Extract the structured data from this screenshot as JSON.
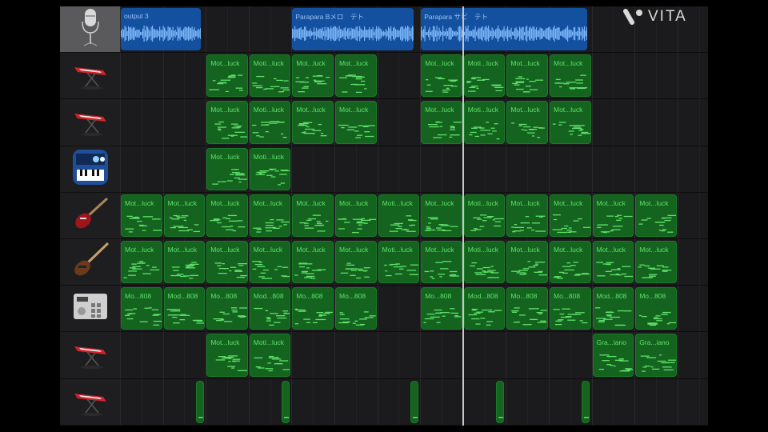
{
  "logo": {
    "text": "VITA"
  },
  "colors": {
    "midi": "#14631f",
    "audio": "#1450a0",
    "midi_text": "#5fe06a",
    "audio_text": "#9cc2f2"
  },
  "tracks": [
    {
      "instrument": "microphone-icon",
      "selected": true,
      "regions": [
        {
          "type": "audio",
          "label": "output 3",
          "start": 0,
          "length": 1.9
        },
        {
          "type": "audio",
          "label": "Parapara Bメロ　テト",
          "start": 4,
          "length": 2.87
        },
        {
          "type": "audio",
          "label": "Parapara サビ　テト",
          "start": 7,
          "length": 3.92
        }
      ]
    },
    {
      "instrument": "keyboard-icon",
      "regions": [
        {
          "type": "midi",
          "label": "Mot...luck",
          "start": 2,
          "length": 1
        },
        {
          "type": "midi",
          "label": "Moti...luck",
          "start": 3,
          "length": 1
        },
        {
          "type": "midi",
          "label": "Mot...luck",
          "start": 4,
          "length": 1
        },
        {
          "type": "midi",
          "label": "Mot...luck",
          "start": 5,
          "length": 1
        },
        {
          "type": "midi",
          "label": "Mot...luck",
          "start": 7,
          "length": 1
        },
        {
          "type": "midi",
          "label": "Moti...luck",
          "start": 8,
          "length": 1
        },
        {
          "type": "midi",
          "label": "Mot...luck",
          "start": 9,
          "length": 1
        },
        {
          "type": "midi",
          "label": "Mot...luck",
          "start": 10,
          "length": 1
        }
      ]
    },
    {
      "instrument": "keyboard-icon",
      "regions": [
        {
          "type": "midi",
          "label": "Mot...luck",
          "start": 2,
          "length": 1
        },
        {
          "type": "midi",
          "label": "Moti...luck",
          "start": 3,
          "length": 1
        },
        {
          "type": "midi",
          "label": "Mot...luck",
          "start": 4,
          "length": 1
        },
        {
          "type": "midi",
          "label": "Mot...luck",
          "start": 5,
          "length": 1
        },
        {
          "type": "midi",
          "label": "Mot...luck",
          "start": 7,
          "length": 1
        },
        {
          "type": "midi",
          "label": "Moti...luck",
          "start": 8,
          "length": 1
        },
        {
          "type": "midi",
          "label": "Mot...luck",
          "start": 9,
          "length": 1
        },
        {
          "type": "midi",
          "label": "Mot...luck",
          "start": 10,
          "length": 1
        }
      ]
    },
    {
      "instrument": "synth-app-icon",
      "regions": [
        {
          "type": "midi",
          "label": "Mot...luck",
          "start": 2,
          "length": 1
        },
        {
          "type": "midi",
          "label": "Moti...luck",
          "start": 3,
          "length": 1
        }
      ]
    },
    {
      "instrument": "electric-guitar-icon",
      "regions": [
        {
          "type": "midi",
          "label": "Mot...luck",
          "start": 0,
          "length": 1
        },
        {
          "type": "midi",
          "label": "Mot...luck",
          "start": 1,
          "length": 1
        },
        {
          "type": "midi",
          "label": "Mot...luck",
          "start": 2,
          "length": 1
        },
        {
          "type": "midi",
          "label": "Mot...luck",
          "start": 3,
          "length": 1
        },
        {
          "type": "midi",
          "label": "Mot...luck",
          "start": 4,
          "length": 1
        },
        {
          "type": "midi",
          "label": "Mot...luck",
          "start": 5,
          "length": 1
        },
        {
          "type": "midi",
          "label": "Moti...luck",
          "start": 6,
          "length": 1
        },
        {
          "type": "midi",
          "label": "Mot...luck",
          "start": 7,
          "length": 1
        },
        {
          "type": "midi",
          "label": "Moti...luck",
          "start": 8,
          "length": 1
        },
        {
          "type": "midi",
          "label": "Mot...luck",
          "start": 9,
          "length": 1
        },
        {
          "type": "midi",
          "label": "Mot...luck",
          "start": 10,
          "length": 1
        },
        {
          "type": "midi",
          "label": "Mot...luck",
          "start": 11,
          "length": 1
        },
        {
          "type": "midi",
          "label": "Mot...luck",
          "start": 12,
          "length": 1
        }
      ]
    },
    {
      "instrument": "bass-guitar-icon",
      "regions": [
        {
          "type": "midi",
          "label": "Mot...luck",
          "start": 0,
          "length": 1
        },
        {
          "type": "midi",
          "label": "Mot...luck",
          "start": 1,
          "length": 1
        },
        {
          "type": "midi",
          "label": "Mot...luck",
          "start": 2,
          "length": 1
        },
        {
          "type": "midi",
          "label": "Mot...luck",
          "start": 3,
          "length": 1
        },
        {
          "type": "midi",
          "label": "Mot...luck",
          "start": 4,
          "length": 1
        },
        {
          "type": "midi",
          "label": "Mot...luck",
          "start": 5,
          "length": 1
        },
        {
          "type": "midi",
          "label": "Moti...luck",
          "start": 6,
          "length": 1
        },
        {
          "type": "midi",
          "label": "Mot...luck",
          "start": 7,
          "length": 1
        },
        {
          "type": "midi",
          "label": "Moti...luck",
          "start": 8,
          "length": 1
        },
        {
          "type": "midi",
          "label": "Mot...luck",
          "start": 9,
          "length": 1
        },
        {
          "type": "midi",
          "label": "Mot...luck",
          "start": 10,
          "length": 1
        },
        {
          "type": "midi",
          "label": "Mot...luck",
          "start": 11,
          "length": 1
        },
        {
          "type": "midi",
          "label": "Mot...luck",
          "start": 12,
          "length": 1
        }
      ]
    },
    {
      "instrument": "drum-machine-icon",
      "regions": [
        {
          "type": "midi",
          "label": "Mo...808",
          "start": 0,
          "length": 1
        },
        {
          "type": "midi",
          "label": "Mod...808",
          "start": 1,
          "length": 1
        },
        {
          "type": "midi",
          "label": "Mo...808",
          "start": 2,
          "length": 1
        },
        {
          "type": "midi",
          "label": "Mod...808",
          "start": 3,
          "length": 1
        },
        {
          "type": "midi",
          "label": "Mo...808",
          "start": 4,
          "length": 1
        },
        {
          "type": "midi",
          "label": "Mo...808",
          "start": 5,
          "length": 1
        },
        {
          "type": "midi",
          "label": "Mo...808",
          "start": 7,
          "length": 1
        },
        {
          "type": "midi",
          "label": "Mod...808",
          "start": 8,
          "length": 1
        },
        {
          "type": "midi",
          "label": "Mo...808",
          "start": 9,
          "length": 1
        },
        {
          "type": "midi",
          "label": "Mo...808",
          "start": 10,
          "length": 1
        },
        {
          "type": "midi",
          "label": "Mod...808",
          "start": 11,
          "length": 1
        },
        {
          "type": "midi",
          "label": "Mo...808",
          "start": 12,
          "length": 1
        }
      ]
    },
    {
      "instrument": "keyboard-icon",
      "regions": [
        {
          "type": "midi",
          "label": "Mot...luck",
          "start": 2,
          "length": 1
        },
        {
          "type": "midi",
          "label": "Moti...luck",
          "start": 3,
          "length": 1
        },
        {
          "type": "midi",
          "label": "Gra...iano",
          "start": 11,
          "length": 1
        },
        {
          "type": "midi",
          "label": "Gra...iano",
          "start": 12,
          "length": 1
        }
      ]
    },
    {
      "instrument": "keyboard-icon",
      "regions": [
        {
          "type": "midi",
          "label": "",
          "start": 1.75,
          "length": 0.22
        },
        {
          "type": "midi",
          "label": "",
          "start": 3.75,
          "length": 0.22
        },
        {
          "type": "midi",
          "label": "",
          "start": 6.75,
          "length": 0.22
        },
        {
          "type": "midi",
          "label": "",
          "start": 8.75,
          "length": 0.22
        },
        {
          "type": "midi",
          "label": "",
          "start": 10.75,
          "length": 0.22
        }
      ]
    }
  ],
  "playhead_bar": 8
}
